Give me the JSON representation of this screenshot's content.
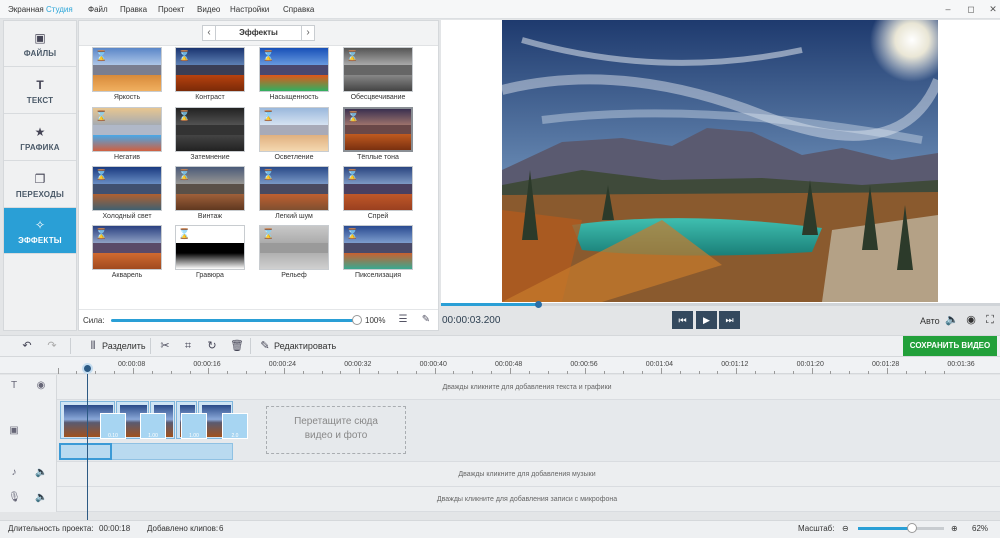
{
  "app": {
    "title_main": "Экранная ",
    "title_accent": "Студия"
  },
  "menu": [
    "Файл",
    "Правка",
    "Проект",
    "Видео",
    "Настройки",
    "Справка"
  ],
  "window_controls": {
    "minimize": "–",
    "restore": "◻",
    "close": "✕"
  },
  "sidebar": [
    {
      "label": "ФАЙЛЫ",
      "icon": "image-icon",
      "glyph": "▣"
    },
    {
      "label": "ТЕКСТ",
      "icon": "text-icon",
      "glyph": "T"
    },
    {
      "label": "ГРАФИКА",
      "icon": "star-icon",
      "glyph": "★"
    },
    {
      "label": "ПЕРЕХОДЫ",
      "icon": "transition-icon",
      "glyph": "❐"
    },
    {
      "label": "ЭФФЕКТЫ",
      "icon": "magic-wand-icon",
      "glyph": "✧",
      "active": true
    }
  ],
  "effects": {
    "title": "Эффекты",
    "prev": "‹",
    "next": "›",
    "items": [
      {
        "label": "Яркость",
        "style": "bright"
      },
      {
        "label": "Контраст",
        "style": "contrast"
      },
      {
        "label": "Насыщенность",
        "style": "saturate"
      },
      {
        "label": "Обесцвечивание",
        "style": "gray"
      },
      {
        "label": "Негатив",
        "style": "negative"
      },
      {
        "label": "Затемнение",
        "style": "dark"
      },
      {
        "label": "Осветление",
        "style": "light"
      },
      {
        "label": "Тёплые тона",
        "style": "warm",
        "selected": true
      },
      {
        "label": "Холодный свет",
        "style": "cold"
      },
      {
        "label": "Винтаж",
        "style": "vintage"
      },
      {
        "label": "Легкий шум",
        "style": "noise"
      },
      {
        "label": "Спрей",
        "style": "spray"
      },
      {
        "label": "Акварель",
        "style": "watercolor"
      },
      {
        "label": "Гравюра",
        "style": "engrave"
      },
      {
        "label": "Рельеф",
        "style": "relief"
      },
      {
        "label": "Пикселизация",
        "style": "pixel"
      }
    ],
    "strength_label": "Сила:",
    "strength_value": "100%",
    "strength_fraction": 1.0
  },
  "player": {
    "timecode": "00:00:03.200",
    "auto_label": "Авто",
    "progress_fraction": 0.17
  },
  "toolbar": {
    "split": "Разделить",
    "edit": "Редактировать",
    "save": "СОХРАНИТЬ ВИДЕО"
  },
  "ruler": [
    "00:00:08",
    "00:00:16",
    "00:00:24",
    "00:00:32",
    "00:00:40",
    "00:00:48",
    "00:00:56",
    "00:01:04",
    "00:01:12",
    "00:01:20",
    "00:01:28",
    "00:01:36"
  ],
  "tracks": {
    "text_hint": "Дважды кликните для добавления текста и графики",
    "drop_hint_1": "Перетащите сюда",
    "drop_hint_2": "видео и фото",
    "music_hint": "Дважды кликните для добавления музыки",
    "mic_hint": "Дважды кликните для добавления записи с микрофона",
    "transitions": [
      "0.10",
      "1.00",
      "1.00",
      "2.0"
    ]
  },
  "status": {
    "duration_label": "Длительность проекта:",
    "duration_value": "00:00:18",
    "clips_label": "Добавлено клипов:",
    "clips_value": "6",
    "zoom_label": "Масштаб:",
    "zoom_value": "62%",
    "zoom_fraction": 0.62
  },
  "colors": {
    "accent": "#2a9fd6",
    "save_green": "#22a03a",
    "player_btn": "#34495e"
  }
}
